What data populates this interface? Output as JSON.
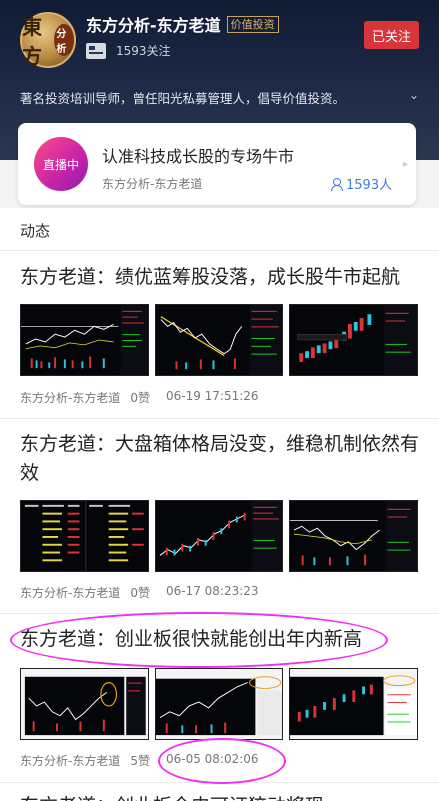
{
  "profile": {
    "avatar_text": "東方",
    "avatar_badge": "分析",
    "name": "东方分析-东方老道",
    "tag": "价值投资",
    "fans": "1593关注",
    "follow_button": "已关注",
    "intro": "著名投资培训导师，曾任阳光私募管理人，倡导价值投资。",
    "intro_toggle": "⌄"
  },
  "live": {
    "badge": "直播中",
    "title": "认准科技成长股的专场牛市",
    "author": "东方分析-东方老道",
    "viewers": "1593人",
    "arrow": "▸"
  },
  "feed": {
    "section_label": "动态",
    "posts": [
      {
        "title": "东方老道：绩优蓝筹股没落，成长股牛市起航",
        "author": "东方分析-东方老道",
        "likes": "0赞",
        "date": "06-19 17:51:26"
      },
      {
        "title": "东方老道：大盘箱体格局没变，维稳机制依然有效",
        "author": "东方分析-东方老道",
        "likes": "0赞",
        "date": "06-17 08:23:23"
      },
      {
        "title": "东方老道：创业板很快就能创出年内新高",
        "author": "东方分析-东方老道",
        "likes": "5赞",
        "date": "06-05 08:02:06"
      },
      {
        "title": "东方老道：创业板今史可证猝动将现"
      }
    ]
  },
  "colors": {
    "follow_red": "#d8353b",
    "link_blue": "#3a7be0",
    "annotation_magenta": "#ee31ee"
  }
}
